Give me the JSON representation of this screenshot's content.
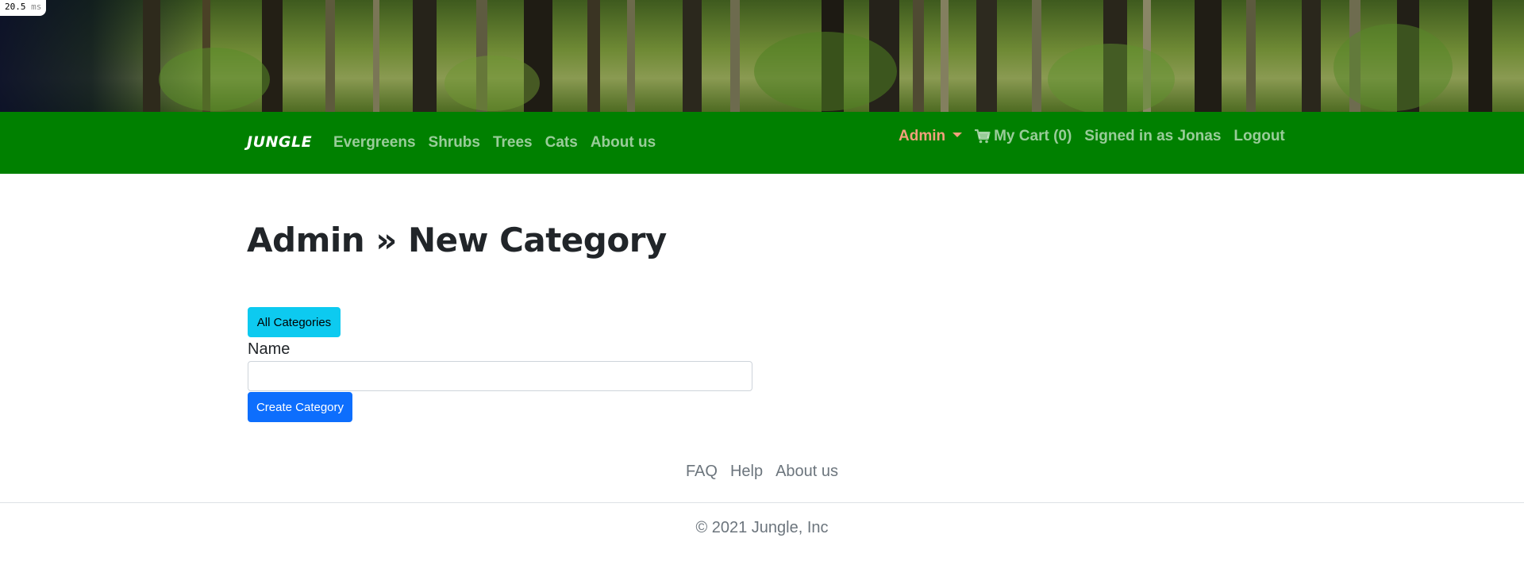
{
  "timer": {
    "value": "20.5",
    "unit": "ms"
  },
  "navbar": {
    "brand": "JUNGLE",
    "links": [
      "Evergreens",
      "Shrubs",
      "Trees",
      "Cats",
      "About us"
    ],
    "admin_label": "Admin",
    "cart_label": "My Cart (0)",
    "signed_in": "Signed in as Jonas",
    "logout": "Logout"
  },
  "page": {
    "title": "Admin » New Category",
    "all_categories_button": "All Categories",
    "name_label": "Name",
    "name_value": "",
    "create_button": "Create Category"
  },
  "footer": {
    "links": [
      "FAQ",
      "Help",
      "About us"
    ],
    "copyright": "© 2021 Jungle, Inc"
  },
  "colors": {
    "navbar_bg": "#008000",
    "admin_accent": "#f2a07c",
    "info_button": "#0dcaf0",
    "primary_button": "#0d6efd"
  },
  "icons": [
    "cart-icon",
    "caret-down-icon"
  ]
}
